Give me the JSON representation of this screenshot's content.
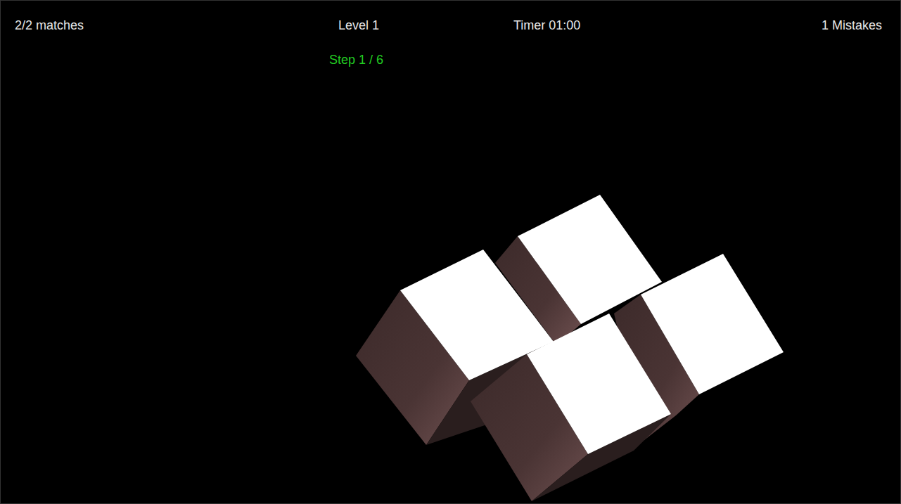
{
  "hud": {
    "matches": "2/2 matches",
    "level": "Level 1",
    "timer": "Timer 01:00",
    "mistakes": "1 Mistakes",
    "step": "Step 1 / 6"
  }
}
